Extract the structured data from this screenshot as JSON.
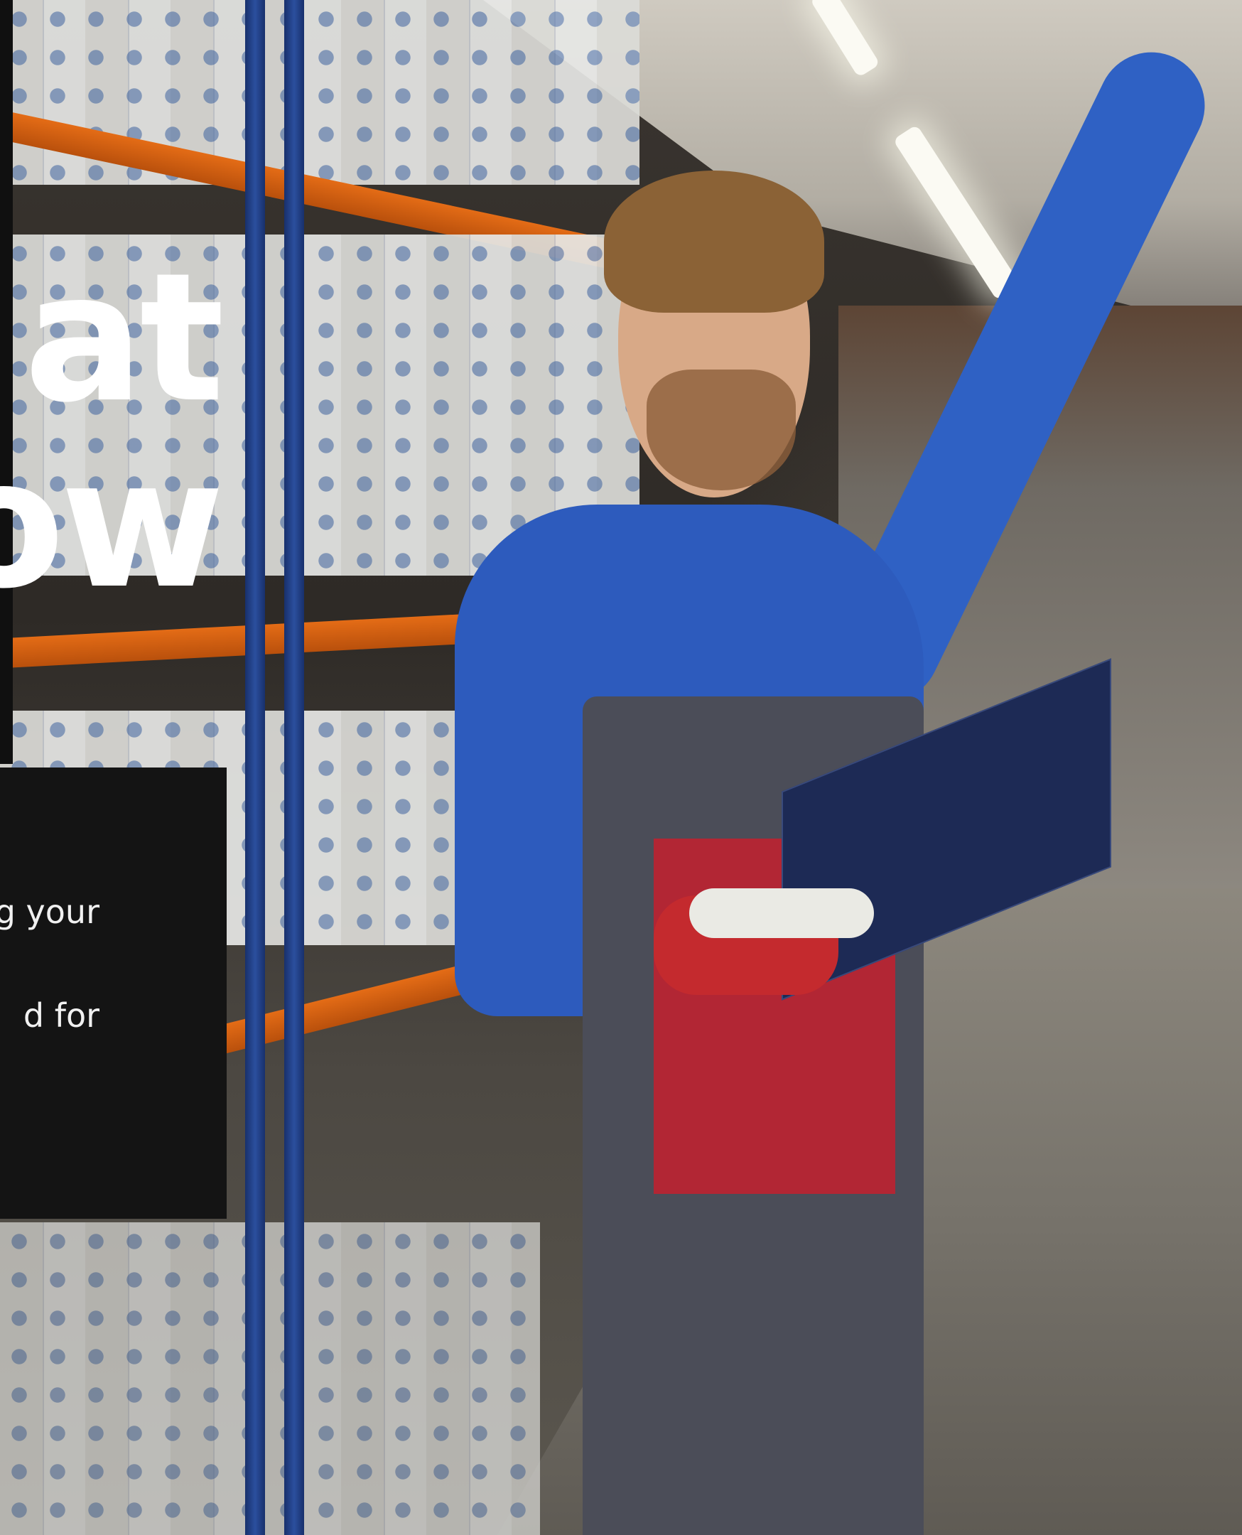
{
  "hero": {
    "headline_lines": [
      "at",
      "ow"
    ]
  },
  "card": {
    "lines": [
      "g your",
      "d for"
    ]
  },
  "colors": {
    "card_background": "#141414",
    "headline_text": "#ffffff",
    "card_text": "#f1f1f1"
  }
}
